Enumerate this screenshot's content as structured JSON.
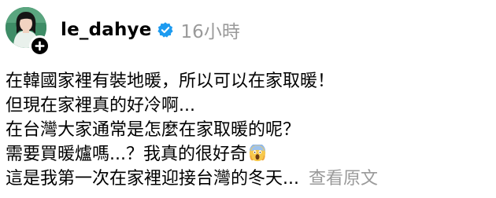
{
  "post": {
    "username": "le_dahye",
    "timestamp": "16小時",
    "verified_icon": "verified-badge-icon",
    "follow_icon": "plus-icon",
    "accent_color": "#1d9bf0",
    "lines": [
      "在韓國家裡有裝地暖，所以可以在家取暖！",
      "但現在家裡真的好冷啊...",
      "在台灣大家通常是怎麼在家取暖的呢？",
      "需要買暖爐嗎...？我真的很好奇",
      "這是我第一次在家裡迎接台灣的冬天..."
    ],
    "emoji": "screaming-face-icon",
    "see_more_label": "查看原文"
  }
}
